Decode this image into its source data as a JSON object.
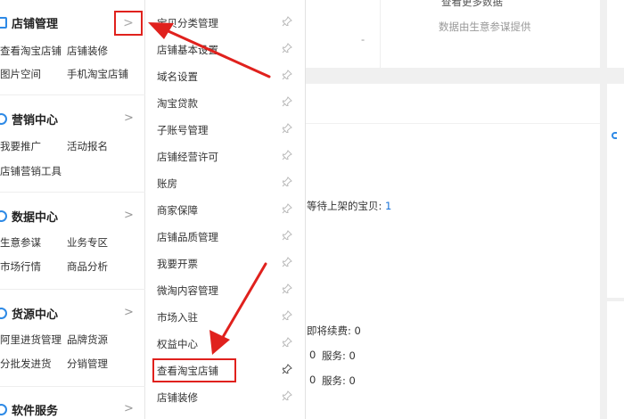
{
  "sidebar": {
    "sections": [
      {
        "title": "店铺管理",
        "links": [
          "查看淘宝店铺",
          "店铺装修",
          "图片空间",
          "手机淘宝店铺"
        ]
      },
      {
        "title": "营销中心",
        "links": [
          "我要推广",
          "活动报名",
          "店铺营销工具"
        ]
      },
      {
        "title": "数据中心",
        "links": [
          "生意参谋",
          "业务专区",
          "市场行情",
          "商品分析"
        ]
      },
      {
        "title": "货源中心",
        "links": [
          "阿里进货管理",
          "品牌货源",
          "分批发进货",
          "分销管理"
        ]
      },
      {
        "title": "软件服务",
        "links": []
      }
    ],
    "chevron": ">"
  },
  "flyout": {
    "items": [
      "宝贝分类管理",
      "店铺基本设置",
      "域名设置",
      "淘宝贷款",
      "子账号管理",
      "店铺经营许可",
      "账房",
      "商家保障",
      "店铺品质管理",
      "我要开票",
      "微淘内容管理",
      "市场入驻",
      "权益中心",
      "查看淘宝店铺",
      "店铺装修"
    ],
    "highlighted_index": 13
  },
  "main": {
    "top_header_partial": "查看更多数据",
    "data_source_note": "数据由生意参谋提供",
    "dot": "-",
    "pending_label": "等待上架的宝贝:",
    "pending_count": "1",
    "renew_label": "即将续费: 0",
    "row1_left": "0",
    "row1_service": "服务: 0",
    "row2_left": "0",
    "row2_service": "服务: 0"
  },
  "colors": {
    "accent": "#2e8ae6",
    "annotation_red": "#e0211d",
    "link_blue": "#1a73d9"
  }
}
